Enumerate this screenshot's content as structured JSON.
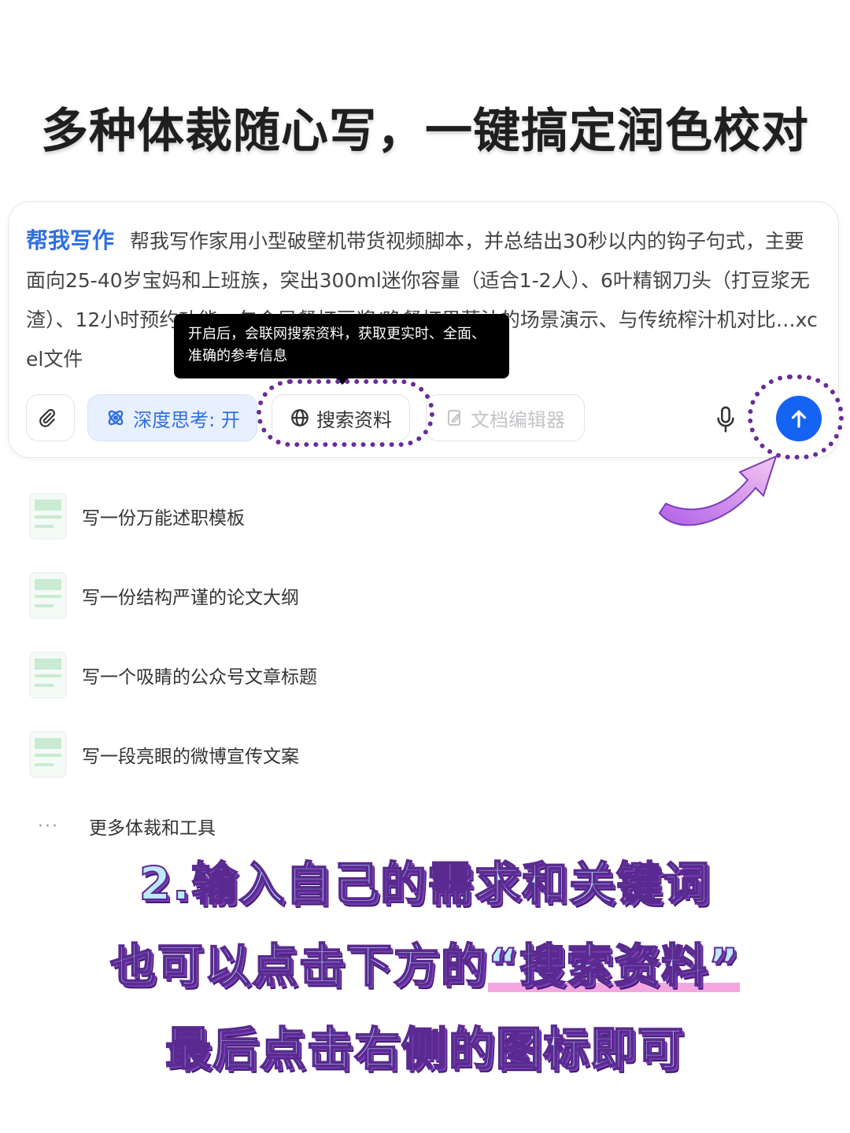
{
  "headline": "多种体裁随心写，一键搞定润色校对",
  "composer": {
    "tag": "帮我写作",
    "prompt_text": "帮我写作家用小型破壁机带货视频脚本，并总结出30秒以内的钩子句式，主要面向25-40岁宝妈和上班族，突出300ml迷你容量（适合1-2人）、6叶精钢刀头（打豆浆无渣）、12小时预约功能，包含早餐打豆浆/晚餐打果蔬汁的场景演示、与传统榨汁机对比…xcel文件",
    "tooltip": "开启后，会联网搜索资料，获取更实时、全面、准确的参考信息",
    "buttons": {
      "think": "深度思考: 开",
      "search": "搜索资料",
      "editor": "文档编辑器"
    },
    "accent": "#1463f3"
  },
  "suggestions": [
    "写一份万能述职模板",
    "写一份结构严谨的论文大纲",
    "写一个吸睛的公众号文章标题",
    "写一段亮眼的微博宣传文案"
  ],
  "more": {
    "dots": "···",
    "label": "更多体裁和工具"
  },
  "captions": {
    "line1": "2.输入自己的需求和关键词",
    "line2_pre": "也可以点击下方的",
    "line2_hl": "“搜索资料”",
    "line3": "最后点击右侧的图标即可"
  },
  "colors": {
    "annotation": "#6a2c97",
    "caption_fill": "#bde9ff"
  }
}
